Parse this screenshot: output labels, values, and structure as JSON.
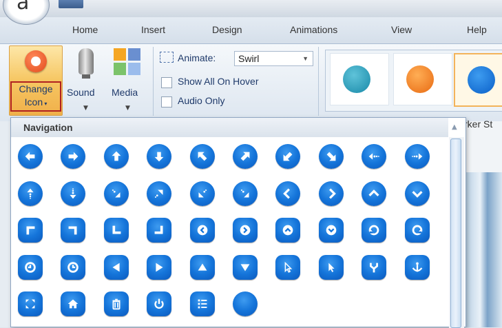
{
  "app": {
    "logo_letter": "a"
  },
  "tabs": [
    {
      "label": "Home"
    },
    {
      "label": "Insert"
    },
    {
      "label": "Design"
    },
    {
      "label": "Animations"
    },
    {
      "label": "View"
    },
    {
      "label": "Help"
    }
  ],
  "ribbon": {
    "change_icon": {
      "line1": "Change",
      "line2": "Icon"
    },
    "sound_label": "Sound",
    "media_label": "Media",
    "animate_label": "Animate:",
    "animate_value": "Swirl",
    "show_all_on_hover": "Show All On Hover",
    "audio_only": "Audio Only",
    "partial_gallery_label": "rker St"
  },
  "dropdown": {
    "header": "Navigation",
    "icons": [
      "arrow-left",
      "arrow-right",
      "arrow-up",
      "arrow-down",
      "arrow-up-left",
      "arrow-up-right",
      "arrow-down-left",
      "arrow-down-right",
      "arrow-left-dots",
      "arrow-right-dots",
      "arrow-up-dots",
      "arrow-down-dots",
      "arrow-diag-down-right-dots",
      "arrow-diag-up-right-dots",
      "arrow-diag-down-left-dots",
      "arrow-diag-down-right-dots-2",
      "chevron-left",
      "chevron-right",
      "chevron-up",
      "chevron-down",
      "corner-top-left",
      "corner-top-right",
      "corner-bottom-left",
      "corner-bottom-right",
      "circle-chevron-left",
      "circle-chevron-right",
      "circle-chevron-up",
      "circle-chevron-down",
      "rotate-ccw",
      "rotate-cw",
      "clock-left",
      "clock-right",
      "triangle-left",
      "triangle-right",
      "triangle-up",
      "triangle-down",
      "cursor-outline",
      "cursor-filled",
      "fork",
      "anchor",
      "expand",
      "home",
      "trash",
      "power",
      "list",
      "blank"
    ]
  }
}
